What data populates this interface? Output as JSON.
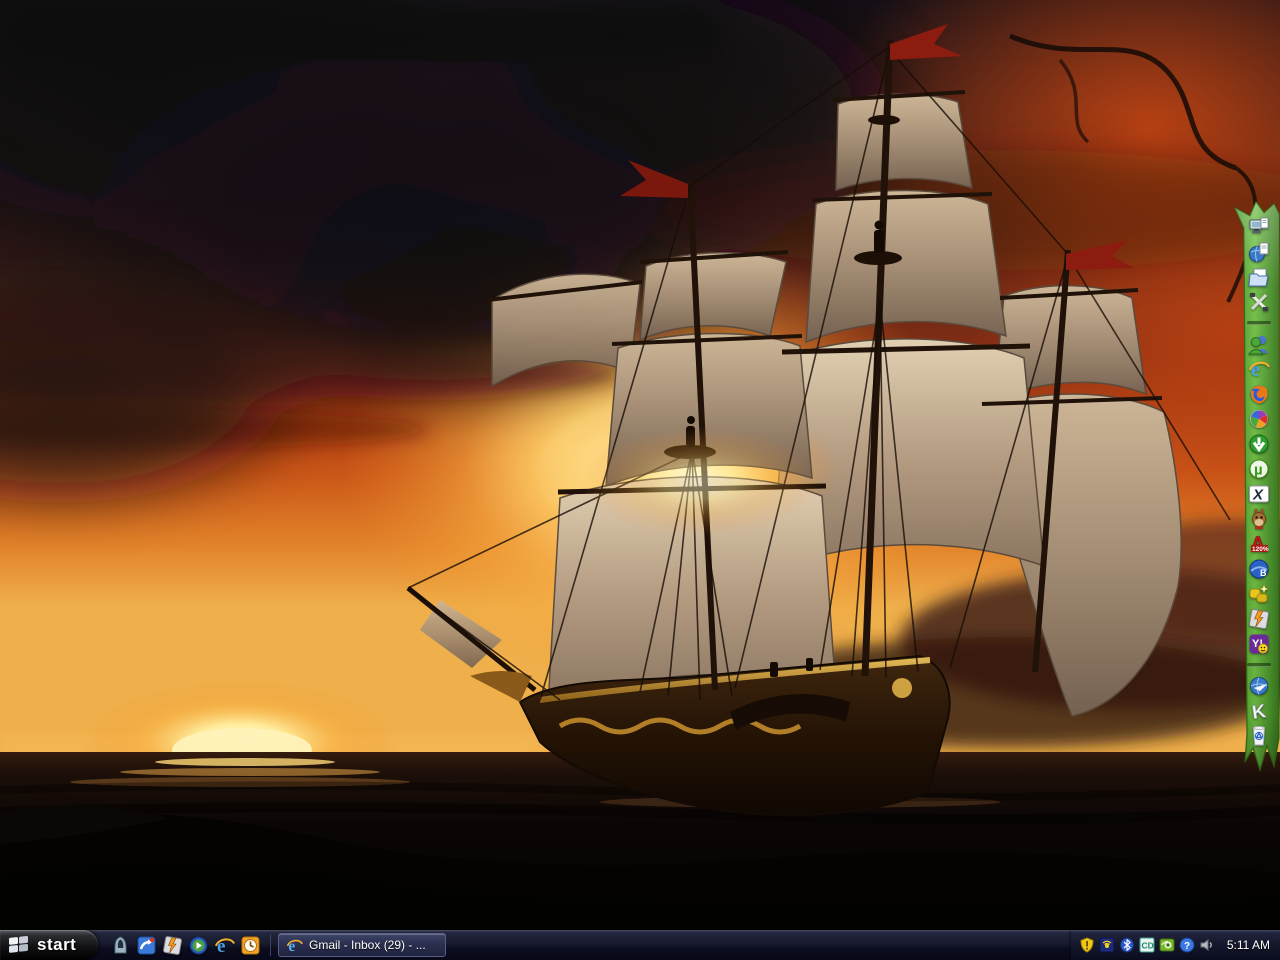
{
  "wallpaper": {
    "description": "Painting of a three-masted pirate galleon with billowing tan sails on a dark ocean, backlit by a fiery orange sunset; dark storm clouds upper left, sun on the horizon lower left, red pennant flags on mastheads"
  },
  "dock": {
    "items": [
      {
        "name": "computer-documents-icon"
      },
      {
        "name": "globe-documents-icon"
      },
      {
        "name": "folder-documents-icon"
      },
      {
        "name": "crossed-tools-icon"
      },
      {
        "name": "user-accounts-icon"
      },
      {
        "name": "internet-explorer-icon"
      },
      {
        "name": "firefox-icon"
      },
      {
        "name": "picasa-icon"
      },
      {
        "name": "download-arrow-icon"
      },
      {
        "name": "utorrent-icon"
      },
      {
        "name": "xfire-icon"
      },
      {
        "name": "emule-donkey-icon"
      },
      {
        "name": "alcohol-120-icon"
      },
      {
        "name": "bsplayer-globe-icon"
      },
      {
        "name": "yellow-keys-icon"
      },
      {
        "name": "winamp-icon"
      },
      {
        "name": "yahoo-messenger-icon"
      },
      {
        "name": "globe-tools-icon"
      },
      {
        "name": "k-codec-icon"
      },
      {
        "name": "recycle-cup-icon"
      }
    ]
  },
  "taskbar": {
    "start": {
      "label": "start"
    },
    "quick_launch": [
      {
        "name": "hooded-figure-icon"
      },
      {
        "name": "messenger-icon"
      },
      {
        "name": "winamp-icon"
      },
      {
        "name": "media-player-icon"
      },
      {
        "name": "internet-explorer-icon"
      },
      {
        "name": "clock-app-icon"
      }
    ],
    "windows": [
      {
        "label": "Gmail - Inbox (29) - ...",
        "icon": "internet-explorer-icon"
      }
    ],
    "tray": [
      {
        "name": "security-shield-icon"
      },
      {
        "name": "wireless-signal-icon"
      },
      {
        "name": "bluetooth-icon"
      },
      {
        "name": "cd-player-icon"
      },
      {
        "name": "nvidia-icon"
      },
      {
        "name": "help-icon"
      },
      {
        "name": "volume-icon"
      }
    ],
    "clock": "5:11 AM"
  },
  "glyphs": {
    "ie_e": "e",
    "utorrent": "µ",
    "xfire": "X",
    "alcohol_a": "A",
    "alcohol_pct": "120%",
    "bsplayer": "B",
    "yahoo": "Y!",
    "k": "K",
    "cd": "CD",
    "help": "?"
  },
  "colors": {
    "dock_green": "#5aa82e",
    "sky_orange": "#c85417",
    "sun_yellow": "#fff3b8",
    "sail_tan": "#cdb697",
    "taskbar_dark": "#15182c",
    "flag_red": "#8c1c10"
  }
}
